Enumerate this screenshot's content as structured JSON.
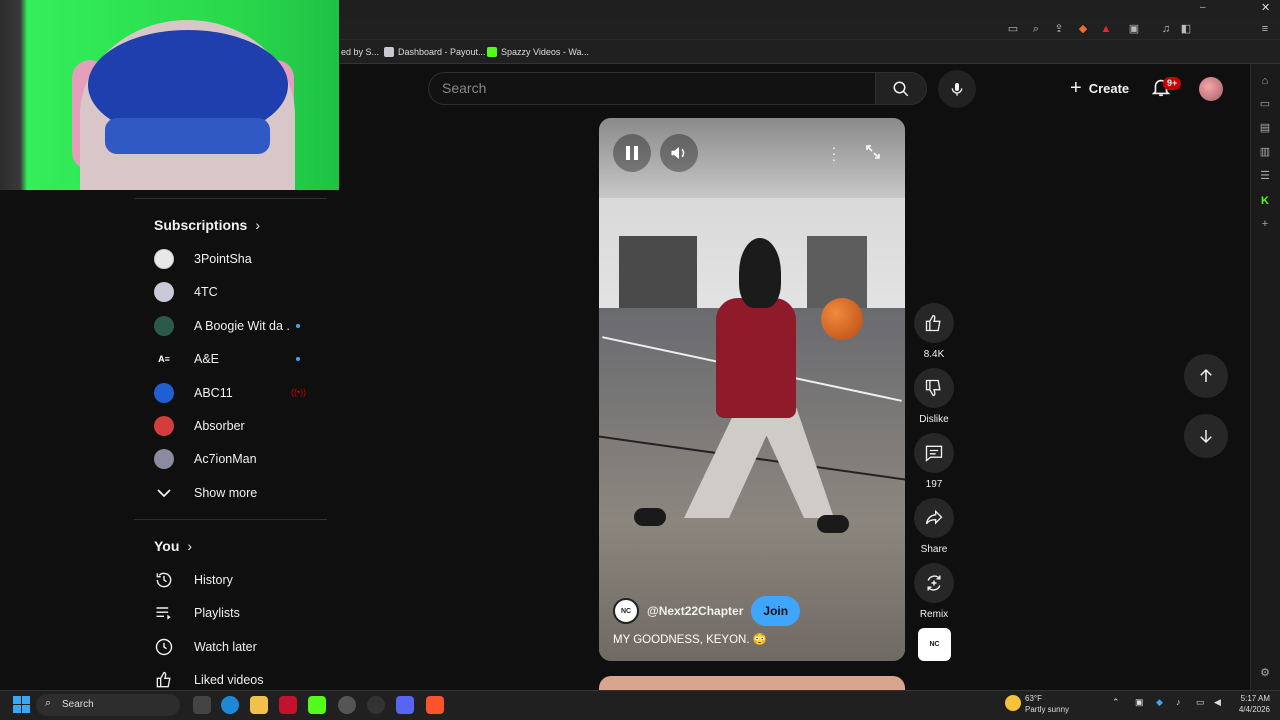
{
  "browser": {
    "bookmarks": [
      {
        "label": "ed by S..."
      },
      {
        "label": "Dashboard - Payout..."
      },
      {
        "label": "Spazzy Videos - Wa..."
      }
    ]
  },
  "topbar": {
    "search_placeholder": "Search",
    "create_label": "Create",
    "notification_badge": "9+"
  },
  "guide": {
    "subscriptions_title": "Subscriptions",
    "subscriptions": [
      {
        "name": "3PointSha",
        "avatar_color": "#e8e8e8",
        "indicator": ""
      },
      {
        "name": "4TC",
        "avatar_color": "#c9c9d8",
        "indicator": ""
      },
      {
        "name": "A Boogie Wit da ...",
        "avatar_color": "#2b5a4a",
        "indicator": "new"
      },
      {
        "name": "A&E",
        "avatar_color": "#0f0f0f",
        "indicator": "new"
      },
      {
        "name": "ABC11",
        "avatar_color": "#1f5fd1",
        "indicator": "live"
      },
      {
        "name": "Absorber",
        "avatar_color": "#d43d3d",
        "indicator": ""
      },
      {
        "name": "Ac7ionMan",
        "avatar_color": "#8a8aa0",
        "indicator": ""
      }
    ],
    "show_more_label": "Show more",
    "you_title": "You",
    "you_items": [
      {
        "label": "History",
        "icon": "history-icon"
      },
      {
        "label": "Playlists",
        "icon": "playlists-icon"
      },
      {
        "label": "Watch later",
        "icon": "watch-later-icon"
      },
      {
        "label": "Liked videos",
        "icon": "liked-videos-icon"
      }
    ]
  },
  "short": {
    "channel_handle": "@Next22Chapter",
    "channel_avatar_text": "NC",
    "join_label": "Join",
    "caption": "MY GOODNESS, KEYON. 😳"
  },
  "actions": {
    "likes": "8.4K",
    "dislike_label": "Dislike",
    "comments": "197",
    "share_label": "Share",
    "remix_label": "Remix"
  },
  "taskbar": {
    "search_label": "Search",
    "weather_temp": "63°F",
    "weather_desc": "Partly sunny",
    "time": "5:17 AM",
    "date": "4/4/2026"
  },
  "colors": {
    "background": "#0f0f0f",
    "accent_blue": "#3ea6ff",
    "badge_red": "#cc0000",
    "webcam_green": "#2bd94a"
  }
}
